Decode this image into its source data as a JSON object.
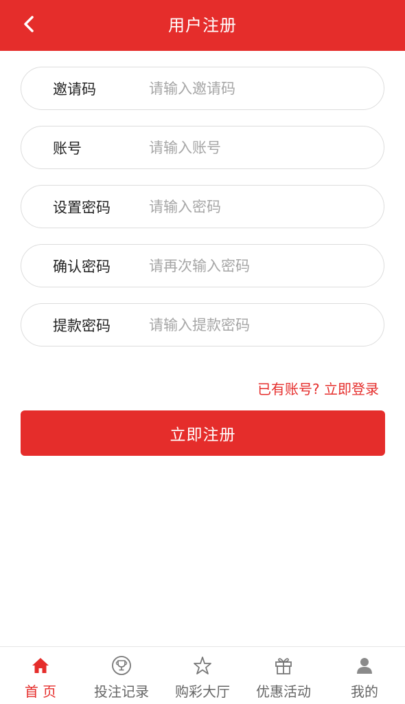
{
  "header": {
    "title": "用户注册",
    "back_icon": "chevron-left-icon"
  },
  "form": {
    "fields": [
      {
        "label": "邀请码",
        "placeholder": "请输入邀请码",
        "value": ""
      },
      {
        "label": "账号",
        "placeholder": "请输入账号",
        "value": ""
      },
      {
        "label": "设置密码",
        "placeholder": "请输入密码",
        "value": ""
      },
      {
        "label": "确认密码",
        "placeholder": "请再次输入密码",
        "value": ""
      },
      {
        "label": "提款密码",
        "placeholder": "请输入提款密码",
        "value": ""
      }
    ],
    "login_link": "已有账号? 立即登录",
    "register_button": "立即注册"
  },
  "tabbar": {
    "items": [
      {
        "label": "首 页",
        "icon": "home-icon",
        "active": true
      },
      {
        "label": "投注记录",
        "icon": "trophy-icon",
        "active": false
      },
      {
        "label": "购彩大厅",
        "icon": "star-icon",
        "active": false
      },
      {
        "label": "优惠活动",
        "icon": "gift-icon",
        "active": false
      },
      {
        "label": "我的",
        "icon": "user-icon",
        "active": false
      }
    ]
  },
  "colors": {
    "primary": "#e52d2b",
    "tab_inactive": "#666666",
    "placeholder": "#a6a6a6"
  }
}
